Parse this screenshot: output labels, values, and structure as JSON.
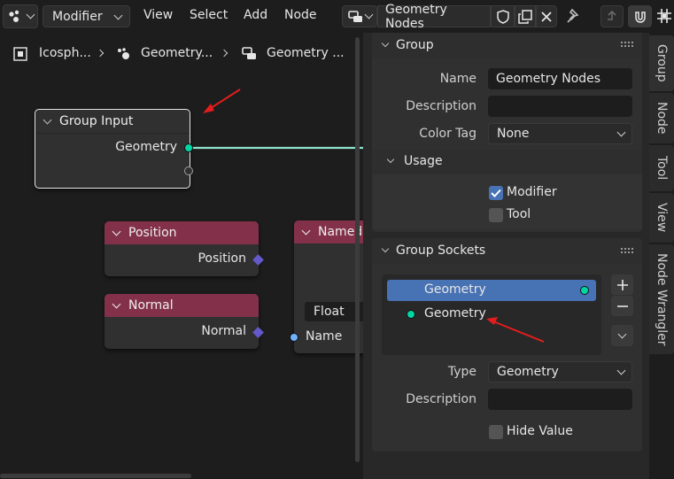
{
  "header": {
    "editor_type_icon": "node-tree-icon",
    "modifier_dropdown": "Modifier",
    "menus": [
      "View",
      "Select",
      "Add",
      "Node"
    ],
    "node_tree_name": "Geometry Nodes"
  },
  "breadcrumb": {
    "items": [
      "Icosph...",
      "Geometry...",
      "Geometry ..."
    ]
  },
  "nodes": {
    "group_input": {
      "title": "Group Input",
      "output": "Geometry"
    },
    "position": {
      "title": "Position",
      "output": "Position"
    },
    "normal": {
      "title": "Normal",
      "output": "Normal"
    },
    "named": {
      "title": "Named",
      "type": "Float",
      "input": "Name"
    }
  },
  "colors": {
    "geometry_socket": "#00d6a3",
    "vector_socket": "#6459c9",
    "float_socket": "#a1a1a1",
    "string_socket": "#70b2ff",
    "input_node_header": "#83314a",
    "selection": "#4772b3",
    "annotation_arrow": "#e21d1d"
  },
  "group_panel": {
    "title": "Group",
    "name_label": "Name",
    "name_value": "Geometry Nodes",
    "description_label": "Description",
    "description_value": "",
    "color_tag_label": "Color Tag",
    "color_tag_value": "None",
    "usage_title": "Usage",
    "modifier_label": "Modifier",
    "modifier_checked": true,
    "tool_label": "Tool",
    "tool_checked": false
  },
  "sockets_panel": {
    "title": "Group Sockets",
    "items": [
      {
        "label": "Geometry",
        "selected": true
      },
      {
        "label": "Geometry",
        "selected": false
      }
    ],
    "type_label": "Type",
    "type_value": "Geometry",
    "description_label": "Description",
    "description_value": "",
    "hide_value_label": "Hide Value",
    "hide_value_checked": false
  },
  "side_tabs": [
    "Group",
    "Node",
    "Tool",
    "View",
    "Node Wrangler"
  ]
}
